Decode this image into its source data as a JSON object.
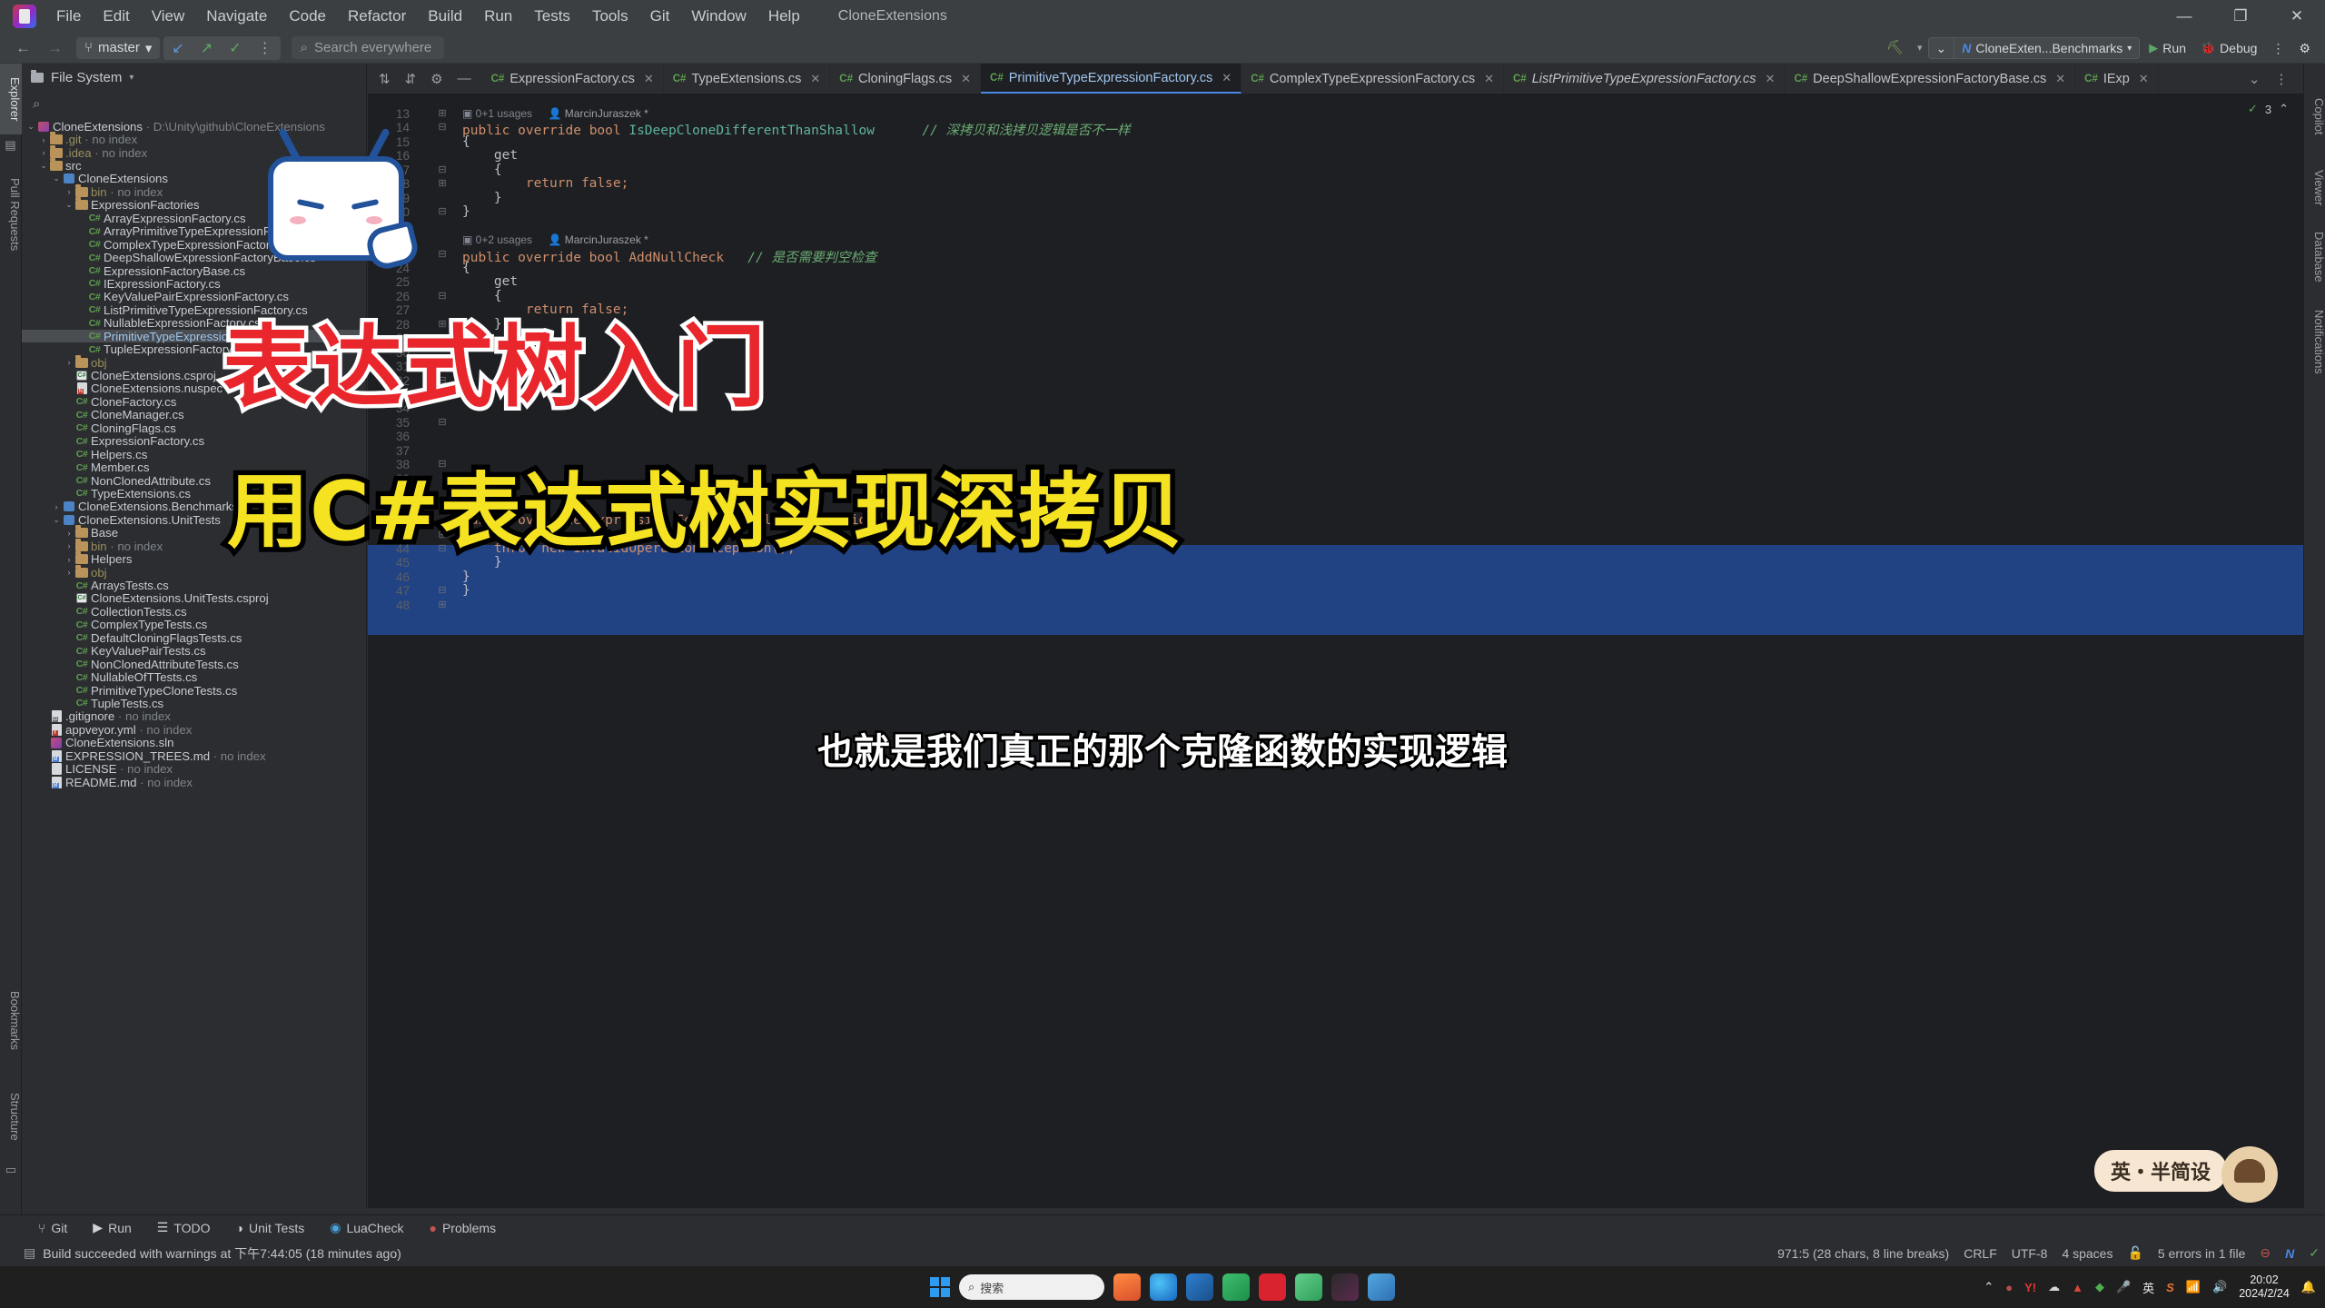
{
  "menubar": {
    "items": [
      "File",
      "Edit",
      "View",
      "Navigate",
      "Code",
      "Refactor",
      "Build",
      "Run",
      "Tests",
      "Tools",
      "Git",
      "Window",
      "Help"
    ],
    "project_name": "CloneExtensions",
    "window_controls": {
      "minimize": "—",
      "maximize": "❐",
      "close": "✕"
    }
  },
  "toolbar": {
    "back": "←",
    "forward": "→",
    "branch": "master",
    "branch_caret": "▾",
    "update_icon": "↙",
    "push_icon": "↗",
    "commit_icon": "✓",
    "more_icon": "⋮",
    "search_placeholder": "Search everywhere",
    "search_icon": "search-icon",
    "build_icon": "hammer-icon",
    "config_name": "CloneExten...Benchmarks",
    "run_label": "Run",
    "debug_label": "Debug",
    "more_label": "⋮",
    "settings_label": "⚙"
  },
  "left_stripe": {
    "labels": [
      "Explorer",
      "Pull Requests",
      "Bookmarks",
      "Structure"
    ]
  },
  "right_stripe": {
    "labels": [
      "Copilot",
      "Viewer",
      "Database",
      "Notifications"
    ]
  },
  "project_panel": {
    "title": "File System",
    "caret": "▾",
    "search_icon": "search-icon",
    "tree": [
      {
        "depth": 0,
        "arrow": "⌄",
        "icon": "module-red",
        "label": "CloneExtensions",
        "sub": " · D:\\Unity\\github\\CloneExtensions"
      },
      {
        "depth": 1,
        "arrow": "›",
        "icon": "folder",
        "label": ".git",
        "sub": " · no index",
        "dim": true
      },
      {
        "depth": 1,
        "arrow": "›",
        "icon": "folder",
        "label": ".idea",
        "sub": " · no index",
        "dim": true
      },
      {
        "depth": 1,
        "arrow": "⌄",
        "icon": "folder",
        "label": "src",
        "sub": ""
      },
      {
        "depth": 2,
        "arrow": "⌄",
        "icon": "module-blue",
        "label": "CloneExtensions",
        "sub": ""
      },
      {
        "depth": 3,
        "arrow": "›",
        "icon": "folder",
        "label": "bin",
        "sub": " · no index",
        "dim": true
      },
      {
        "depth": 3,
        "arrow": "⌄",
        "icon": "folder",
        "label": "ExpressionFactories",
        "sub": ""
      },
      {
        "depth": 4,
        "arrow": "",
        "icon": "cs",
        "label": "ArrayExpressionFactory.cs",
        "sub": ""
      },
      {
        "depth": 4,
        "arrow": "",
        "icon": "cs",
        "label": "ArrayPrimitiveTypeExpressionFactory.cs",
        "sub": ""
      },
      {
        "depth": 4,
        "arrow": "",
        "icon": "cs",
        "label": "ComplexTypeExpressionFactory.cs",
        "sub": ""
      },
      {
        "depth": 4,
        "arrow": "",
        "icon": "cs",
        "label": "DeepShallowExpressionFactoryBase.cs",
        "sub": ""
      },
      {
        "depth": 4,
        "arrow": "",
        "icon": "cs",
        "label": "ExpressionFactoryBase.cs",
        "sub": ""
      },
      {
        "depth": 4,
        "arrow": "",
        "icon": "cs",
        "label": "IExpressionFactory.cs",
        "sub": ""
      },
      {
        "depth": 4,
        "arrow": "",
        "icon": "cs",
        "label": "KeyValuePairExpressionFactory.cs",
        "sub": ""
      },
      {
        "depth": 4,
        "arrow": "",
        "icon": "cs",
        "label": "ListPrimitiveTypeExpressionFactory.cs",
        "sub": ""
      },
      {
        "depth": 4,
        "arrow": "",
        "icon": "cs",
        "label": "NullableExpressionFactory.cs",
        "sub": ""
      },
      {
        "depth": 4,
        "arrow": "",
        "icon": "cs",
        "label": "PrimitiveTypeExpressionFactory.cs",
        "sub": "",
        "selected": true
      },
      {
        "depth": 4,
        "arrow": "",
        "icon": "cs",
        "label": "TupleExpressionFactory.cs",
        "sub": ""
      },
      {
        "depth": 3,
        "arrow": "›",
        "icon": "folder",
        "label": "obj",
        "sub": "",
        "dim": true
      },
      {
        "depth": 3,
        "arrow": "",
        "icon": "csproj",
        "label": "CloneExtensions.csproj",
        "sub": ""
      },
      {
        "depth": 3,
        "arrow": "",
        "icon": "nuspec",
        "label": "CloneExtensions.nuspec",
        "sub": ""
      },
      {
        "depth": 3,
        "arrow": "",
        "icon": "cs",
        "label": "CloneFactory.cs",
        "sub": ""
      },
      {
        "depth": 3,
        "arrow": "",
        "icon": "cs",
        "label": "CloneManager.cs",
        "sub": ""
      },
      {
        "depth": 3,
        "arrow": "",
        "icon": "cs",
        "label": "CloningFlags.cs",
        "sub": ""
      },
      {
        "depth": 3,
        "arrow": "",
        "icon": "cs",
        "label": "ExpressionFactory.cs",
        "sub": ""
      },
      {
        "depth": 3,
        "arrow": "",
        "icon": "cs",
        "label": "Helpers.cs",
        "sub": ""
      },
      {
        "depth": 3,
        "arrow": "",
        "icon": "cs",
        "label": "Member.cs",
        "sub": ""
      },
      {
        "depth": 3,
        "arrow": "",
        "icon": "cs",
        "label": "NonClonedAttribute.cs",
        "sub": ""
      },
      {
        "depth": 3,
        "arrow": "",
        "icon": "cs",
        "label": "TypeExtensions.cs",
        "sub": ""
      },
      {
        "depth": 2,
        "arrow": "›",
        "icon": "module-blue",
        "label": "CloneExtensions.Benchmarks",
        "sub": ""
      },
      {
        "depth": 2,
        "arrow": "⌄",
        "icon": "module-blue",
        "label": "CloneExtensions.UnitTests",
        "sub": ""
      },
      {
        "depth": 3,
        "arrow": "›",
        "icon": "folder",
        "label": "Base",
        "sub": ""
      },
      {
        "depth": 3,
        "arrow": "›",
        "icon": "folder",
        "label": "bin",
        "sub": " · no index",
        "dim": true
      },
      {
        "depth": 3,
        "arrow": "›",
        "icon": "folder",
        "label": "Helpers",
        "sub": ""
      },
      {
        "depth": 3,
        "arrow": "›",
        "icon": "folder",
        "label": "obj",
        "sub": "",
        "dim": true
      },
      {
        "depth": 3,
        "arrow": "",
        "icon": "cs",
        "label": "ArraysTests.cs",
        "sub": ""
      },
      {
        "depth": 3,
        "arrow": "",
        "icon": "csproj",
        "label": "CloneExtensions.UnitTests.csproj",
        "sub": ""
      },
      {
        "depth": 3,
        "arrow": "",
        "icon": "cs",
        "label": "CollectionTests.cs",
        "sub": ""
      },
      {
        "depth": 3,
        "arrow": "",
        "icon": "cs",
        "label": "ComplexTypeTests.cs",
        "sub": ""
      },
      {
        "depth": 3,
        "arrow": "",
        "icon": "cs",
        "label": "DefaultCloningFlagsTests.cs",
        "sub": ""
      },
      {
        "depth": 3,
        "arrow": "",
        "icon": "cs",
        "label": "KeyValuePairTests.cs",
        "sub": ""
      },
      {
        "depth": 3,
        "arrow": "",
        "icon": "cs",
        "label": "NonClonedAttributeTests.cs",
        "sub": ""
      },
      {
        "depth": 3,
        "arrow": "",
        "icon": "cs",
        "label": "NullableOfTTests.cs",
        "sub": ""
      },
      {
        "depth": 3,
        "arrow": "",
        "icon": "cs",
        "label": "PrimitiveTypeCloneTests.cs",
        "sub": ""
      },
      {
        "depth": 3,
        "arrow": "",
        "icon": "cs",
        "label": "TupleTests.cs",
        "sub": ""
      },
      {
        "depth": 1,
        "arrow": "",
        "icon": "gitignore",
        "label": ".gitignore",
        "sub": " · no index"
      },
      {
        "depth": 1,
        "arrow": "",
        "icon": "yml",
        "label": "appveyor.yml",
        "sub": " · no index"
      },
      {
        "depth": 1,
        "arrow": "",
        "icon": "sln",
        "label": "CloneExtensions.sln",
        "sub": ""
      },
      {
        "depth": 1,
        "arrow": "",
        "icon": "md",
        "label": "EXPRESSION_TREES.md",
        "sub": " · no index"
      },
      {
        "depth": 1,
        "arrow": "",
        "icon": "license",
        "label": "LICENSE",
        "sub": " · no index"
      },
      {
        "depth": 1,
        "arrow": "",
        "icon": "md",
        "label": "README.md",
        "sub": " · no index"
      }
    ]
  },
  "editor": {
    "tabs": [
      {
        "label": "ExpressionFactory.cs",
        "active": false,
        "italic": false
      },
      {
        "label": "TypeExtensions.cs",
        "active": false,
        "italic": false
      },
      {
        "label": "CloningFlags.cs",
        "active": false,
        "italic": false
      },
      {
        "label": "PrimitiveTypeExpressionFactory.cs",
        "active": true,
        "italic": false
      },
      {
        "label": "ComplexTypeExpressionFactory.cs",
        "active": false,
        "italic": false
      },
      {
        "label": "ListPrimitiveTypeExpressionFactory.cs",
        "active": false,
        "italic": true
      },
      {
        "label": "DeepShallowExpressionFactoryBase.cs",
        "active": false,
        "italic": false
      },
      {
        "label": "IExp",
        "active": false,
        "italic": false
      }
    ],
    "tab_overflow": "⌄",
    "tab_more": "⋮",
    "inspection_ok": "✓",
    "warning_count": "3",
    "line_numbers": [
      "13",
      "14",
      "15",
      "16",
      "17",
      "18",
      "19",
      "20",
      "21",
      "22",
      "23",
      "24",
      "25",
      "26",
      "27",
      "28",
      "29",
      "30",
      "31",
      "32",
      "33",
      "34",
      "35",
      "36",
      "37",
      "38",
      "39",
      "40",
      "41",
      "42",
      "43",
      "44",
      "45",
      "46",
      "47",
      "48"
    ],
    "code_lines": [
      {
        "y": 0,
        "type": "hint",
        "text": "0+1 usages",
        "author": "MarcinJuraszek *"
      },
      {
        "y": 1,
        "type": "code",
        "segments": [
          {
            "t": "public override ",
            "c": "kw"
          },
          {
            "t": "bool",
            "c": "kw"
          },
          {
            "t": " IsDeepCloneDifferentThanShallow",
            "c": "type"
          },
          {
            "t": "      // 深拷贝和浅拷贝逻辑是否不一样",
            "c": "cmt"
          }
        ]
      },
      {
        "y": 2,
        "type": "code",
        "segments": [
          {
            "t": "{",
            "c": "txt"
          }
        ]
      },
      {
        "y": 3,
        "type": "code",
        "segments": [
          {
            "t": "    get",
            "c": "txt"
          }
        ]
      },
      {
        "y": 4,
        "type": "code",
        "segments": [
          {
            "t": "    {",
            "c": "txt"
          }
        ]
      },
      {
        "y": 5,
        "type": "code",
        "segments": [
          {
            "t": "        return false;",
            "c": "kw"
          }
        ]
      },
      {
        "y": 6,
        "type": "code",
        "segments": [
          {
            "t": "    }",
            "c": "txt"
          }
        ]
      },
      {
        "y": 7,
        "type": "code",
        "segments": [
          {
            "t": "}",
            "c": "txt"
          }
        ]
      },
      {
        "y": 9,
        "type": "hint",
        "text": "0+2 usages",
        "author": "MarcinJuraszek *"
      },
      {
        "y": 10,
        "type": "code",
        "segments": [
          {
            "t": "public override bool AddNullCheck",
            "c": "kw"
          },
          {
            "t": "   // 是否需要判空检查",
            "c": "cmt"
          }
        ]
      },
      {
        "y": 11,
        "type": "code",
        "segments": [
          {
            "t": "{",
            "c": "txt"
          }
        ]
      },
      {
        "y": 12,
        "type": "code",
        "segments": [
          {
            "t": "    get",
            "c": "txt"
          }
        ]
      },
      {
        "y": 13,
        "type": "code",
        "segments": [
          {
            "t": "    {",
            "c": "txt"
          }
        ]
      },
      {
        "y": 14,
        "type": "code",
        "segments": [
          {
            "t": "        return false;",
            "c": "kw"
          }
        ]
      },
      {
        "y": 15,
        "type": "code",
        "segments": [
          {
            "t": "    }",
            "c": "txt"
          }
        ]
      },
      {
        "y": 16,
        "type": "code",
        "segments": [
          {
            "t": "}",
            "c": "txt"
          }
        ]
      },
      {
        "y": 29,
        "type": "code",
        "segments": [
          {
            "t": "public override Expression GetShallowCloneExpression()",
            "c": "kw"
          }
        ]
      },
      {
        "y": 30,
        "type": "code",
        "segments": [
          {
            "t": "{",
            "c": "txt"
          }
        ]
      },
      {
        "y": 31,
        "type": "code",
        "segments": [
          {
            "t": "    throw new InvalidOperationException();",
            "c": "kw"
          }
        ]
      },
      {
        "y": 32,
        "type": "code",
        "segments": [
          {
            "t": "    }",
            "c": "txt"
          }
        ]
      },
      {
        "y": 33,
        "type": "code",
        "segments": [
          {
            "t": "}",
            "c": "txt"
          }
        ]
      },
      {
        "y": 34,
        "type": "code",
        "segments": [
          {
            "t": "}",
            "c": "txt"
          }
        ]
      }
    ]
  },
  "bottom_bar": {
    "items": [
      {
        "icon": "git-icon",
        "label": "Git"
      },
      {
        "icon": "run-icon",
        "label": "Run"
      },
      {
        "icon": "todo-icon",
        "label": "TODO"
      },
      {
        "icon": "unit-tests-icon",
        "label": "Unit Tests"
      },
      {
        "icon": "luacheck-icon",
        "label": "LuaCheck"
      },
      {
        "icon": "problems-icon",
        "label": "Problems"
      }
    ],
    "build_status_icon": "build-icon",
    "build_status": "Build succeeded with warnings at 下午7:44:05  (18 minutes ago)"
  },
  "status_right": {
    "caret_info": "971:5 (28 chars, 8 line breaks)",
    "line_ending": "CRLF",
    "encoding": "UTF-8",
    "indent": "4 spaces",
    "lock_icon": "lock-icon",
    "errors": "5 errors in 1 file",
    "error_icon": "error-icon",
    "nv_icon": "nv-icon",
    "check_icon": "✓"
  },
  "overlays": {
    "title_line1": "表达式树入门",
    "title_line2": "用C#表达式树实现深拷贝",
    "subtitle": "也就是我们真正的那个克隆函数的实现逻辑",
    "watermark": "英・半简设"
  },
  "taskbar": {
    "start_icon": "windows-logo",
    "search_placeholder": "搜索",
    "apps": [
      "edge-browser",
      "vscode",
      "app-green",
      "app-yd",
      "app-green2",
      "rider",
      "app-blue"
    ],
    "tray": [
      "^",
      "app1",
      "yahoo",
      "cloud",
      "fire",
      "green",
      "mic"
    ],
    "ime": "英",
    "sogou": "S",
    "wifi_icon": "wifi-icon",
    "volume_icon": "volume-icon",
    "time": "20:02",
    "date": "2024/2/24"
  }
}
